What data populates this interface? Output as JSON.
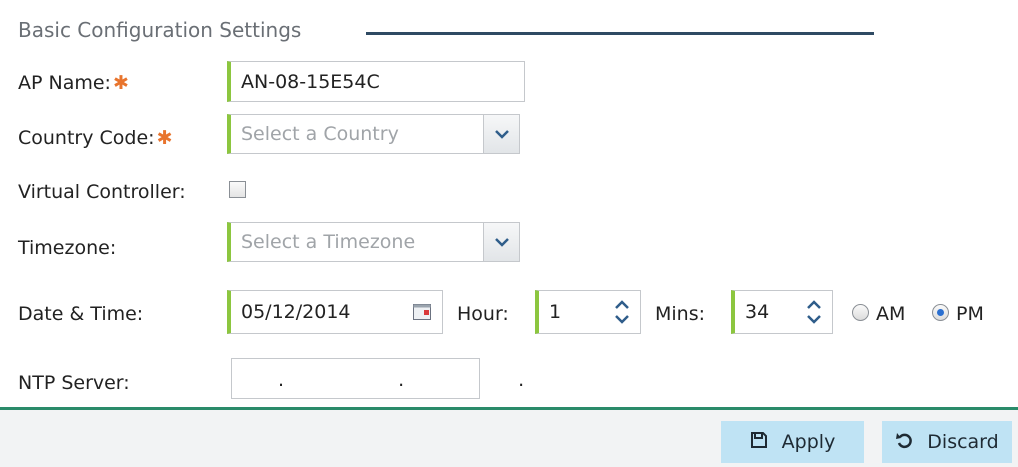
{
  "section": {
    "title": "Basic Configuration Settings"
  },
  "ap_name": {
    "label": "AP Name:",
    "value": "AN-08-15E54C"
  },
  "country": {
    "label": "Country Code:",
    "placeholder": "Select a Country"
  },
  "virtual_controller": {
    "label": "Virtual Controller:",
    "checked": false
  },
  "timezone": {
    "label": "Timezone:",
    "placeholder": "Select a Timezone"
  },
  "datetime": {
    "label": "Date & Time:",
    "date": "05/12/2014",
    "hour_label": "Hour:",
    "hour": "1",
    "mins_label": "Mins:",
    "mins": "34",
    "am_label": "AM",
    "pm_label": "PM",
    "meridiem_selected": "PM"
  },
  "ntp": {
    "label": "NTP Server:",
    "value": ". . ."
  },
  "buttons": {
    "apply": "Apply",
    "discard": "Discard"
  },
  "colors": {
    "accent_green": "#8cc63f",
    "required": "#e8742d",
    "button_bg": "#bfe3f4",
    "title_rule": "#2f4a63"
  }
}
